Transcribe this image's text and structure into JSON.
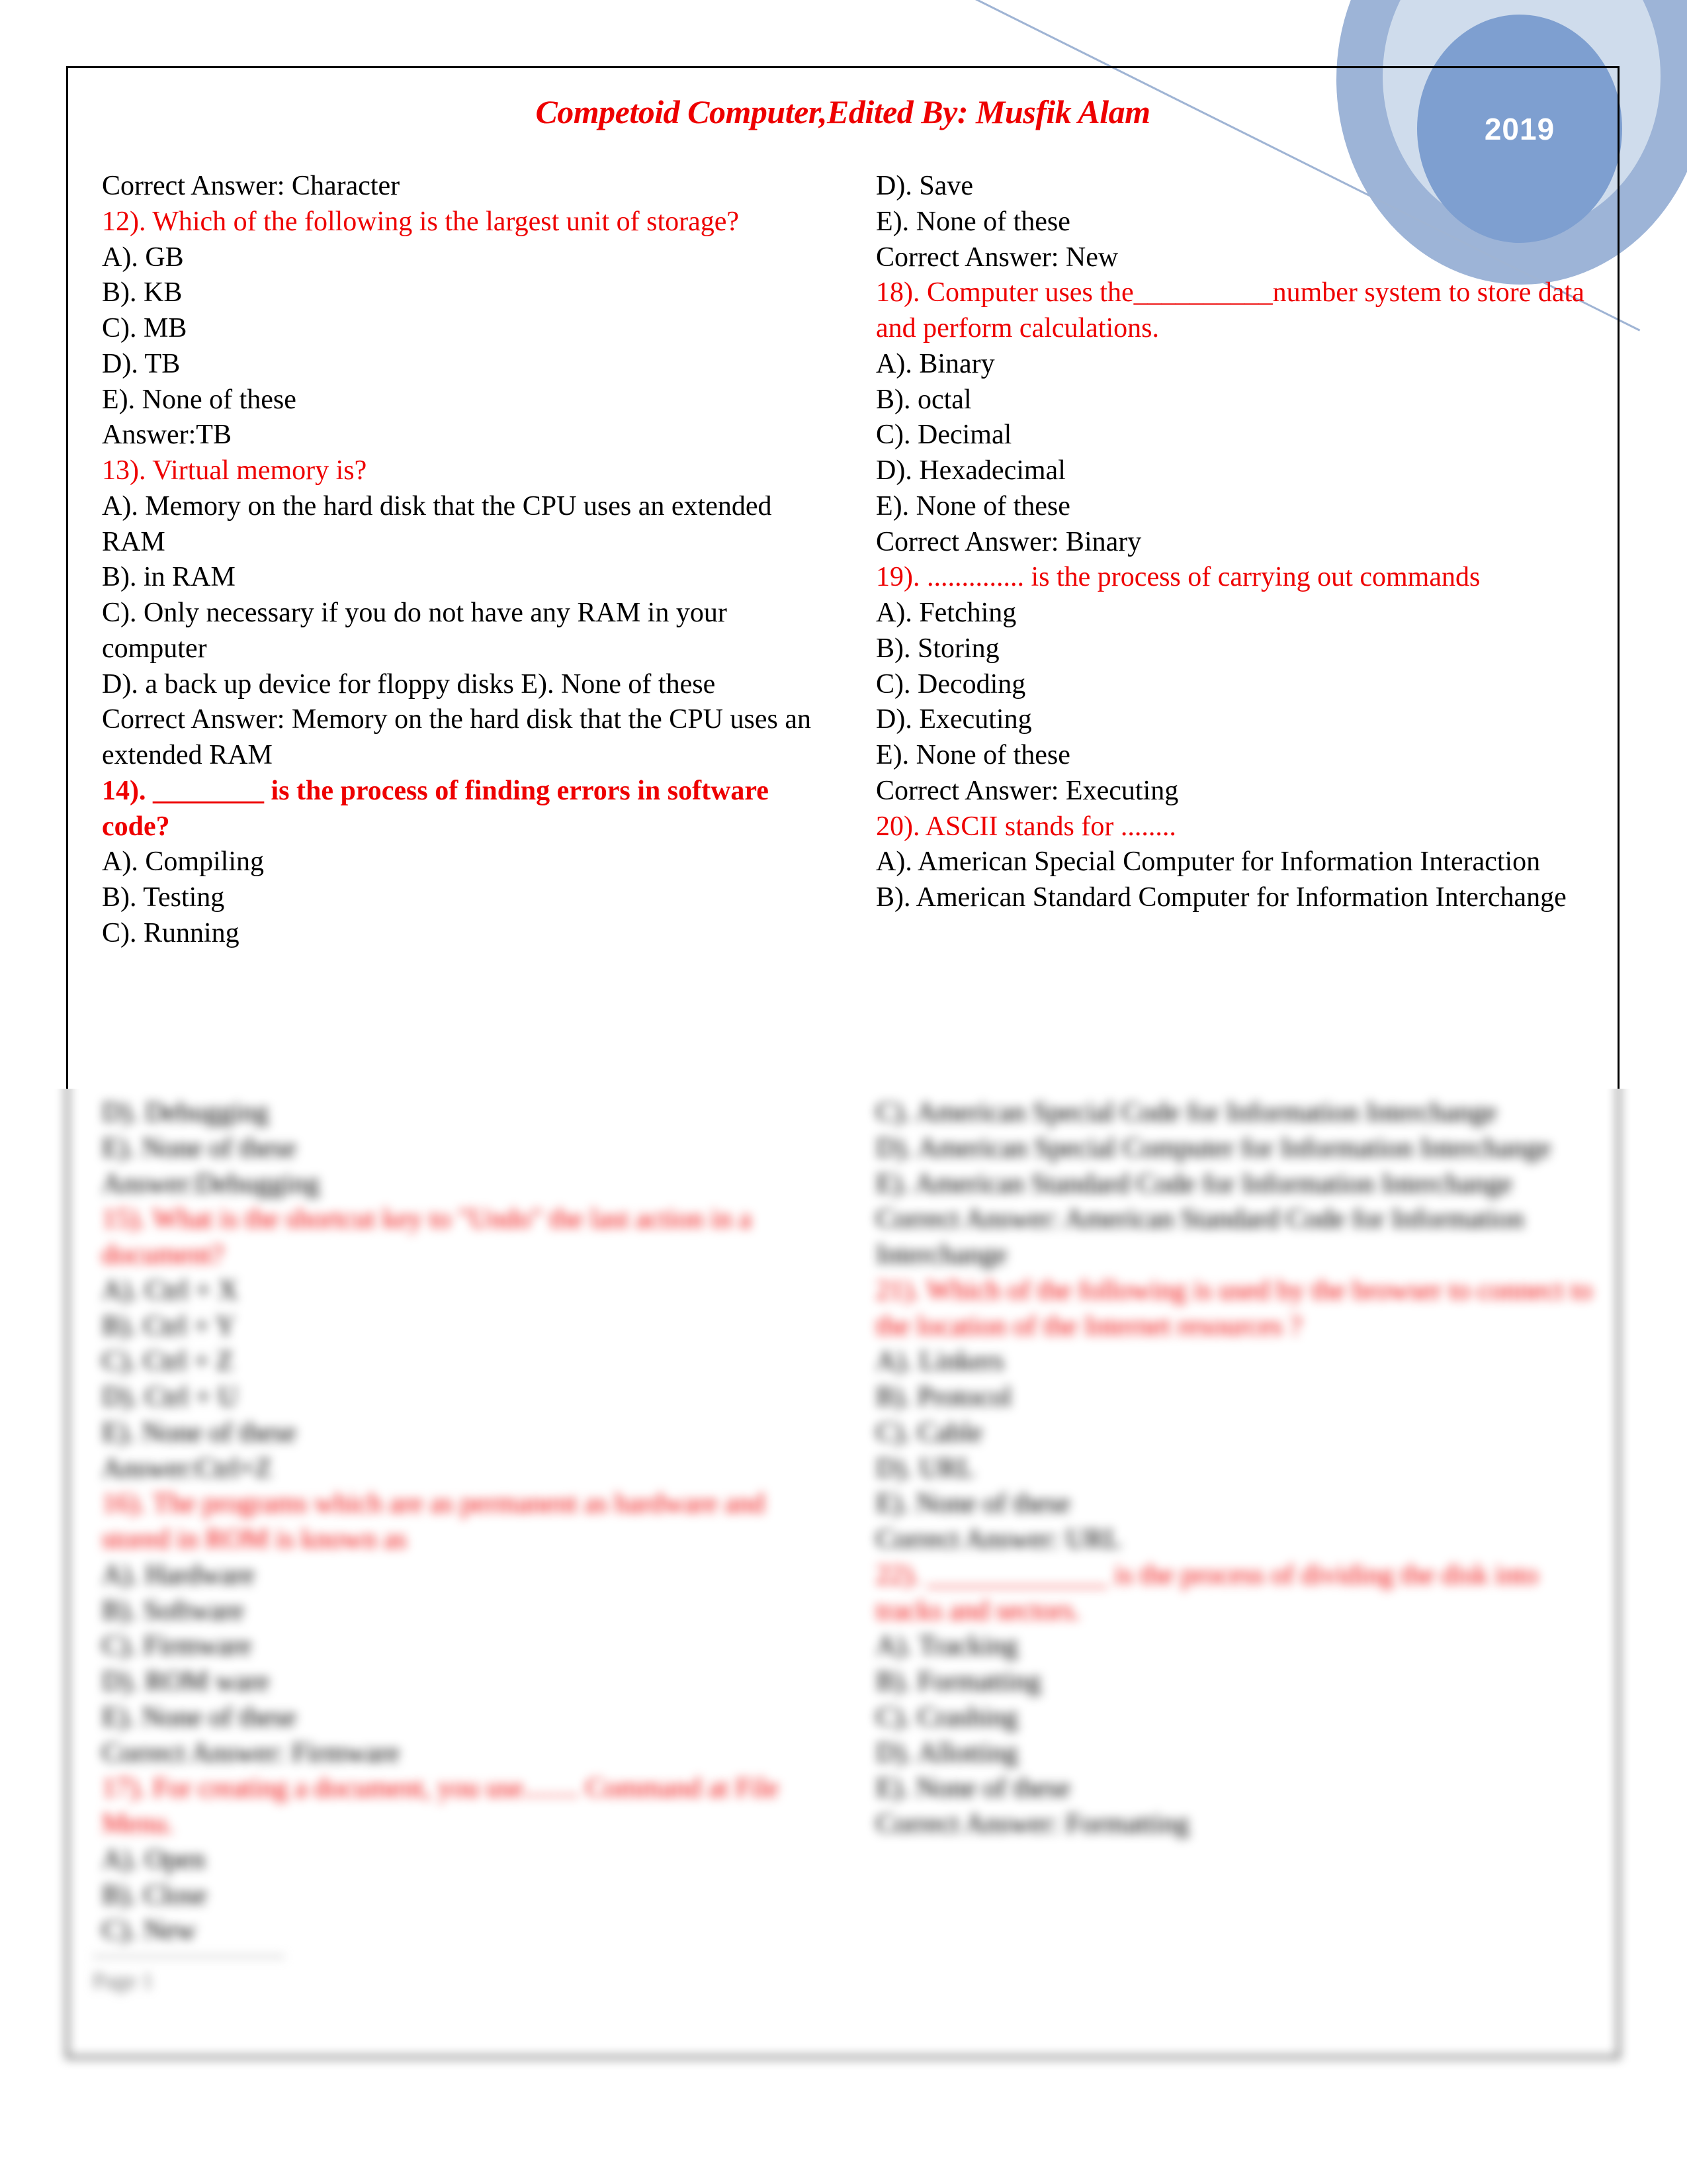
{
  "header": {
    "title": "Competoid Computer,Edited By: Musfik Alam",
    "year_badge": "2019"
  },
  "colors": {
    "question_red": "#ee0000",
    "body_black": "#000000",
    "circle_outer": "#9db4d7",
    "circle_middle": "#cfdcec",
    "circle_inner": "#7e9fd0",
    "diagonal_line": "#9fb4d4"
  },
  "left_column": {
    "sharp": [
      {
        "text": "Correct Answer: Character",
        "style": "answer"
      },
      {
        "text": "12). Which of the following is the largest unit of storage?",
        "style": "question"
      },
      {
        "text": "A). GB",
        "style": "option"
      },
      {
        "text": "B). KB",
        "style": "option"
      },
      {
        "text": "C). MB",
        "style": "option"
      },
      {
        "text": "D). TB",
        "style": "option"
      },
      {
        "text": "E). None of these",
        "style": "option"
      },
      {
        "text": "Answer:TB",
        "style": "answer"
      },
      {
        "text": "13). Virtual memory is?",
        "style": "question"
      },
      {
        "text": "A). Memory on the hard disk that the CPU uses an extended RAM",
        "style": "option"
      },
      {
        "text": "B). in RAM",
        "style": "option"
      },
      {
        "text": "C). Only necessary if you do not have any RAM in your computer",
        "style": "option"
      },
      {
        "text": "D). a back up device for floppy disks E). None of these",
        "style": "option"
      },
      {
        "text": "Correct Answer: Memory on the hard disk that the CPU uses an extended RAM",
        "style": "answer"
      },
      {
        "text": "14). ________ is the process of finding errors in software code?",
        "style": "question-bold"
      },
      {
        "text": "A). Compiling",
        "style": "option"
      },
      {
        "text": "B). Testing",
        "style": "option"
      },
      {
        "text": "C). Running",
        "style": "option"
      }
    ],
    "blurred": [
      {
        "text": "D). Debugging",
        "style": "option"
      },
      {
        "text": "E). None of these",
        "style": "option"
      },
      {
        "text": "Answer:Debugging",
        "style": "answer"
      },
      {
        "text": "15). What is the shortcut key to \"Undo\" the last action in a document?",
        "style": "question"
      },
      {
        "text": "A). Ctrl + X",
        "style": "option"
      },
      {
        "text": "B). Ctrl + Y",
        "style": "option"
      },
      {
        "text": "C). Ctrl + Z",
        "style": "option"
      },
      {
        "text": "D). Ctrl + U",
        "style": "option"
      },
      {
        "text": "E). None of these",
        "style": "option"
      },
      {
        "text": "Answer:Ctrl+Z",
        "style": "answer"
      },
      {
        "text": "16). The programs which are as permanent as hardware and stored in ROM is known as",
        "style": "question"
      },
      {
        "text": "A). Hardware",
        "style": "option"
      },
      {
        "text": "B). Software",
        "style": "option"
      },
      {
        "text": "C). Firmware",
        "style": "option"
      },
      {
        "text": "D). ROM ware",
        "style": "option"
      },
      {
        "text": "E). None of these",
        "style": "option"
      },
      {
        "text": "Correct Answer: Firmware",
        "style": "answer"
      },
      {
        "text": "17). For creating a document, you use........ Command at File Menu.",
        "style": "question"
      },
      {
        "text": "A). Open",
        "style": "option"
      },
      {
        "text": "B). Close",
        "style": "option"
      },
      {
        "text": "C). New",
        "style": "option"
      }
    ]
  },
  "right_column": {
    "sharp": [
      {
        "text": "D). Save",
        "style": "option"
      },
      {
        "text": "E). None of these",
        "style": "option"
      },
      {
        "text": "Correct Answer: New",
        "style": "answer"
      },
      {
        "text": "18). Computer uses the__________number system to store data and perform calculations.",
        "style": "question"
      },
      {
        "text": "A). Binary",
        "style": "option"
      },
      {
        "text": "B). octal",
        "style": "option"
      },
      {
        "text": "C). Decimal",
        "style": "option"
      },
      {
        "text": "D). Hexadecimal",
        "style": "option"
      },
      {
        "text": "E). None of these",
        "style": "option"
      },
      {
        "text": "Correct Answer: Binary",
        "style": "answer"
      },
      {
        "text": "19). .............. is the process of carrying out commands",
        "style": "question"
      },
      {
        "text": "A). Fetching",
        "style": "option"
      },
      {
        "text": "B). Storing",
        "style": "option"
      },
      {
        "text": "C). Decoding",
        "style": "option"
      },
      {
        "text": "D). Executing",
        "style": "option"
      },
      {
        "text": "E). None of these",
        "style": "option"
      },
      {
        "text": "Correct Answer: Executing",
        "style": "answer"
      },
      {
        "text": "20). ASCII stands for ........",
        "style": "question"
      },
      {
        "text": "A). American Special Computer for Information Interaction",
        "style": "option"
      },
      {
        "text": "B). American Standard Computer for Information Interchange",
        "style": "option"
      }
    ],
    "blurred": [
      {
        "text": "C). American Special Code for Information Interchange",
        "style": "option"
      },
      {
        "text": "D). American Special Computer for Information Interchange",
        "style": "option"
      },
      {
        "text": "E). American Standard Code for Information Interchange",
        "style": "option"
      },
      {
        "text": "Correct Answer: American Standard Code for Information Interchange",
        "style": "answer"
      },
      {
        "text": "21). Which of the following is used by the browser to connect to the location of the Internet resources ?",
        "style": "question"
      },
      {
        "text": "A). Linkers",
        "style": "option"
      },
      {
        "text": "B). Protocol",
        "style": "option"
      },
      {
        "text": "C). Cable",
        "style": "option"
      },
      {
        "text": "D). URL",
        "style": "option"
      },
      {
        "text": "E). None of these",
        "style": "option"
      },
      {
        "text": "Correct Answer: URL",
        "style": "answer"
      },
      {
        "text": "22). _____________ is the process of dividing the disk into tracks and sectors.",
        "style": "question"
      },
      {
        "text": "A). Tracking",
        "style": "option"
      },
      {
        "text": "B). Formatting",
        "style": "option"
      },
      {
        "text": "C). Crashing",
        "style": "option"
      },
      {
        "text": "D). Allotting",
        "style": "option"
      },
      {
        "text": "E). None of these",
        "style": "option"
      },
      {
        "text": "Correct Answer: Formatting",
        "style": "answer"
      }
    ]
  },
  "footer": {
    "text": "Page 1"
  }
}
